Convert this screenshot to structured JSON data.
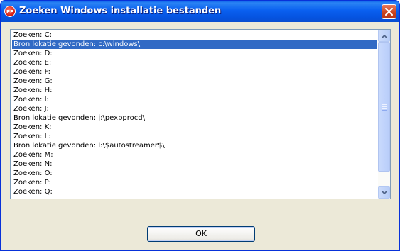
{
  "window": {
    "title": "Zoeken Windows installatie bestanden",
    "icon_text": "PE"
  },
  "list": {
    "selected_index": 1,
    "items": [
      "Zoeken: C:",
      "Bron lokatie gevonden: c:\\windows\\",
      "Zoeken: D:",
      "Zoeken: E:",
      "Zoeken: F:",
      "Zoeken: G:",
      "Zoeken: H:",
      "Zoeken: I:",
      "Zoeken: J:",
      "Bron lokatie gevonden: j:\\pexpprocd\\",
      "Zoeken: K:",
      "Zoeken: L:",
      "Bron lokatie gevonden: l:\\$autostreamer$\\",
      "Zoeken: M:",
      "Zoeken: N:",
      "Zoeken: O:",
      "Zoeken: P:",
      "Zoeken: Q:"
    ]
  },
  "buttons": {
    "ok_label": "OK"
  }
}
